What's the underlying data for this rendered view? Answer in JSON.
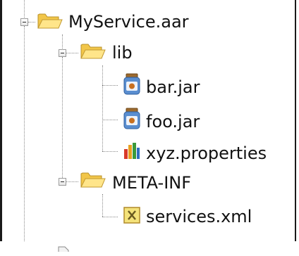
{
  "tree": {
    "root": {
      "label": "MyService.aar",
      "icon": "folder-open-icon",
      "expanded": true
    },
    "lib": {
      "label": "lib",
      "icon": "folder-open-icon",
      "expanded": true,
      "children": [
        {
          "label": "bar.jar",
          "icon": "jar-file-icon"
        },
        {
          "label": "foo.jar",
          "icon": "jar-file-icon"
        },
        {
          "label": "xyz.properties",
          "icon": "properties-file-icon"
        }
      ]
    },
    "meta": {
      "label": "META-INF",
      "icon": "folder-open-icon",
      "expanded": true,
      "children": [
        {
          "label": "services.xml",
          "icon": "xml-file-icon"
        }
      ]
    },
    "next": {
      "icon": "file-icon"
    }
  }
}
